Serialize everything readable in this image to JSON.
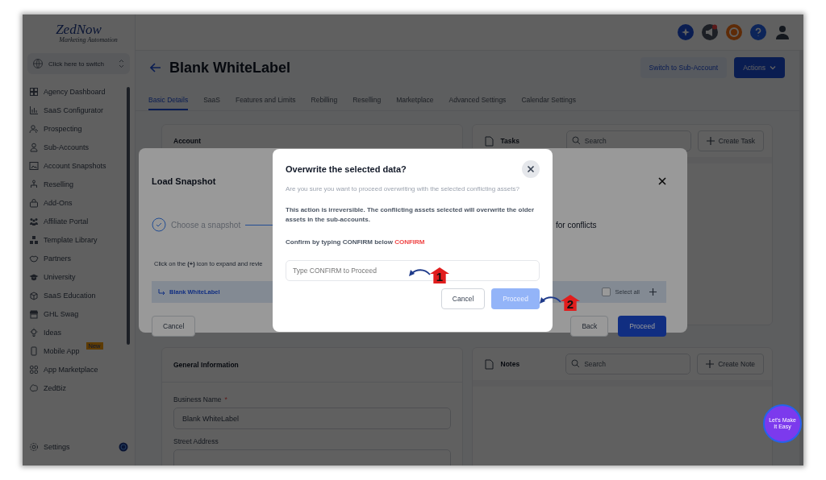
{
  "sidebar": {
    "logo": {
      "name": "ZedNow",
      "tagline": "Marketing Automation"
    },
    "switcher": "Click here to switch",
    "items": [
      {
        "label": "Agency Dashboard"
      },
      {
        "label": "SaaS Configurator"
      },
      {
        "label": "Prospecting"
      },
      {
        "label": "Sub-Accounts"
      },
      {
        "label": "Account Snapshots"
      },
      {
        "label": "Reselling"
      },
      {
        "label": "Add-Ons"
      },
      {
        "label": "Affiliate Portal"
      },
      {
        "label": "Template Library"
      },
      {
        "label": "Partners"
      },
      {
        "label": "University"
      },
      {
        "label": "SaaS Education"
      },
      {
        "label": "GHL Swag"
      },
      {
        "label": "Ideas"
      },
      {
        "label": "Mobile App",
        "badge": "New"
      },
      {
        "label": "App Marketplace"
      },
      {
        "label": "ZedBiz"
      }
    ],
    "settings": "Settings"
  },
  "header": {
    "title": "Blank WhiteLabel",
    "buttons": [
      {
        "label": "Switch to Sub-Account",
        "kind": "secondary"
      },
      {
        "label": "Actions",
        "kind": "primary"
      }
    ]
  },
  "tabs": [
    {
      "label": "Basic Details",
      "selected": true
    },
    {
      "label": "SaaS",
      "selected": false
    },
    {
      "label": "Features and Limits",
      "selected": false
    },
    {
      "label": "Rebilling",
      "selected": false
    },
    {
      "label": "Reselling",
      "selected": false
    },
    {
      "label": "Marketplace",
      "selected": false
    },
    {
      "label": "Advanced Settings",
      "selected": false
    },
    {
      "label": "Calendar Settings",
      "selected": false
    }
  ],
  "account_card": {
    "title": "Account"
  },
  "tasks_card": {
    "title": "Tasks",
    "search_placeholder": "Search",
    "button": "Create Task"
  },
  "general_card": {
    "title": "General Information",
    "fields": [
      {
        "label": "Business Name",
        "required_mark": "*",
        "value": "Blank WhiteLabel"
      },
      {
        "label": "Street Address"
      }
    ]
  },
  "notes_card": {
    "title": "Notes",
    "search_placeholder": "Search",
    "button": "Create Note"
  },
  "load_snapshot": {
    "title": "Load Snapshot",
    "steps": [
      {
        "label": "Choose a snapshot",
        "done": true
      },
      {
        "label": "for conflicts",
        "done": false
      }
    ],
    "instruction": "Click on the **(+)** icon to expand and revie",
    "row_label": "Blank WhiteLabel",
    "select_all": {
      "label": "Select all",
      "checked": false
    },
    "buttons": [
      {
        "label": "Cancel",
        "kind": "secondary"
      },
      {
        "label": "Back",
        "kind": "secondary"
      },
      {
        "label": "Proceed",
        "kind": "primary"
      }
    ]
  },
  "confirm_dialog": {
    "title": "Overwrite the selected data?",
    "question": "Are you sure you want to proceed overwriting with the selected conflicting assets?",
    "warning": "This action is irreversible. The conflicting assets selected will overwrite the older assets in the sub-accounts.",
    "confirm_prompt": "Confirm by typing CONFIRM below",
    "confirm_word": "CONFIRM",
    "input_placeholder": "Type CONFIRM to Proceed",
    "buttons": [
      {
        "label": "Cancel",
        "kind": "secondary",
        "disabled": false
      },
      {
        "label": "Proceed",
        "kind": "primary",
        "disabled": true
      }
    ]
  },
  "annotations": [
    {
      "number": "1"
    },
    {
      "number": "2"
    }
  ],
  "chat_widget": {
    "label": "Let's Make It Easy"
  }
}
